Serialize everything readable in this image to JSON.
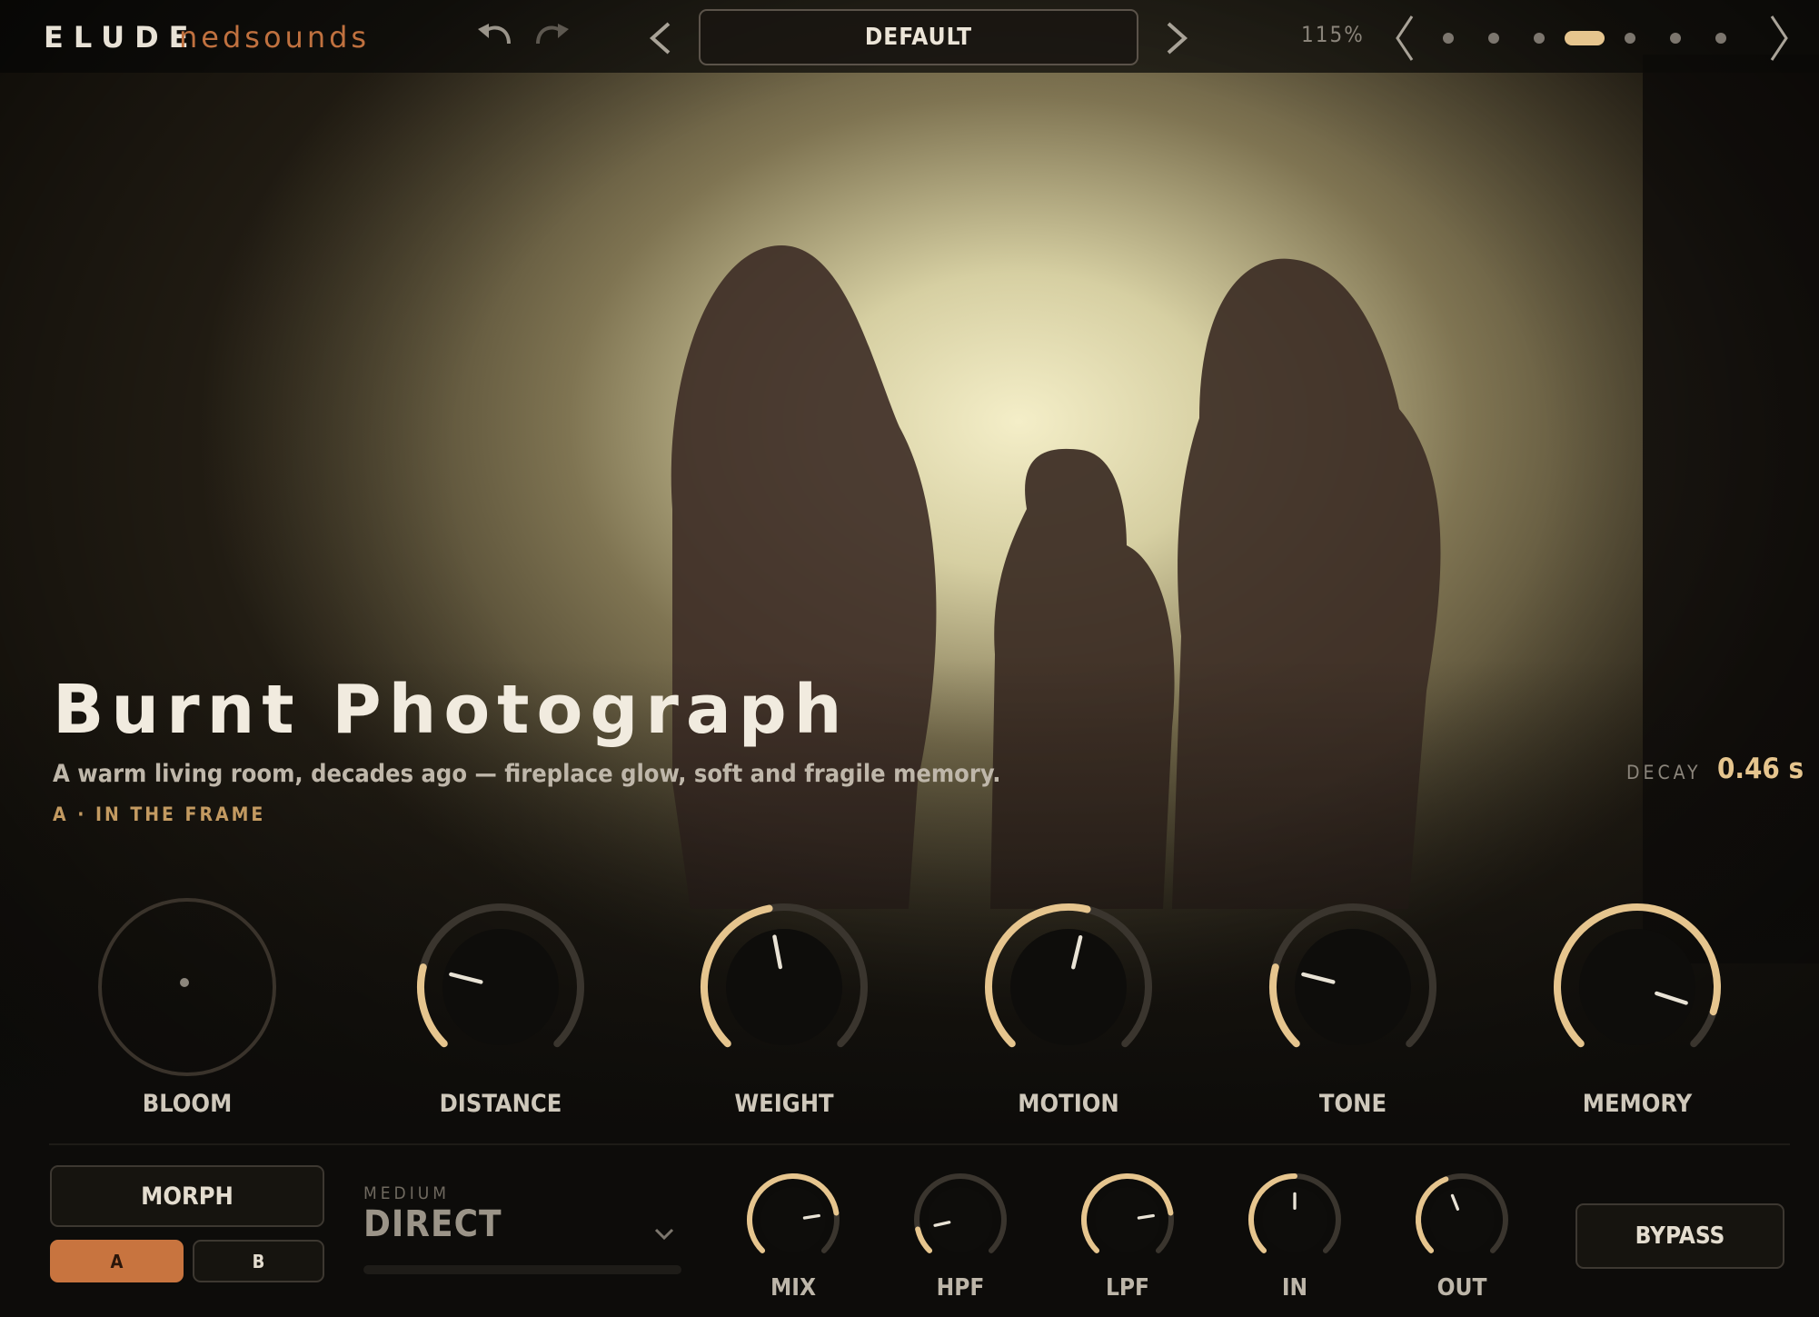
{
  "header": {
    "brand": "ELUDE",
    "vendor": "nedsounds",
    "undo_icon": "undo-icon",
    "redo_icon": "redo-icon",
    "prev_preset_icon": "chevron-left-icon",
    "next_preset_icon": "chevron-right-icon",
    "preset_name": "DEFAULT",
    "zoom": "115%",
    "page_prev_icon": "chevron-left-icon",
    "page_next_icon": "chevron-right-icon",
    "page_dots": 7,
    "page_active_index": 3
  },
  "scene": {
    "title": "Burnt Photograph",
    "description": "A warm living room, decades ago — fireplace glow, soft and fragile memory.",
    "tag": "A · IN THE FRAME",
    "decay_label": "DECAY",
    "decay_value": "0.46 s"
  },
  "macros": [
    {
      "label": "BLOOM",
      "type": "xy-pad"
    },
    {
      "label": "DISTANCE",
      "value": 0.22
    },
    {
      "label": "WEIGHT",
      "value": 0.46
    },
    {
      "label": "MOTION",
      "value": 0.55
    },
    {
      "label": "TONE",
      "value": 0.22
    },
    {
      "label": "MEMORY",
      "value": 0.9
    }
  ],
  "bottom": {
    "morph_label": "MORPH",
    "a_label": "A",
    "b_label": "B",
    "medium_label": "MEDIUM",
    "medium_value": "DIRECT",
    "bypass_label": "BYPASS"
  },
  "small_knobs": [
    {
      "label": "MIX",
      "value": 0.8
    },
    {
      "label": "HPF",
      "value": 0.12
    },
    {
      "label": "LPF",
      "value": 0.8
    },
    {
      "label": "IN",
      "value": 0.5
    },
    {
      "label": "OUT",
      "value": 0.42
    }
  ],
  "colors": {
    "accent": "#e6c58e",
    "vendor": "#c0713f",
    "active_tab": "#c8743f"
  }
}
